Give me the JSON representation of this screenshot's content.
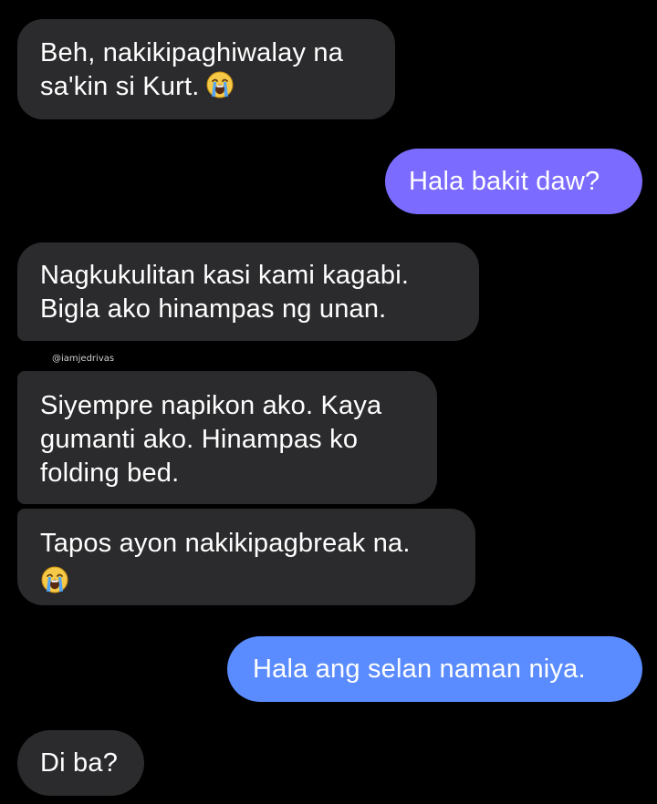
{
  "messages": [
    {
      "sender": "other",
      "lines": [
        "Beh, nakikipaghiwalay na",
        "sa'kin si Kurt."
      ],
      "emoji": "loudly-crying-face-emoji"
    },
    {
      "sender": "me",
      "text": "Hala bakit daw?",
      "color": "#7b6cff"
    },
    {
      "sender": "other",
      "lines": [
        "Nagkukulitan kasi kami kagabi.",
        "Bigla ako hinampas ng unan."
      ]
    },
    {
      "sender": "other",
      "lines": [
        "Siyempre napikon ako. Kaya",
        "gumanti ako. Hinampas ko",
        "folding bed."
      ]
    },
    {
      "sender": "other",
      "lines": [
        "Tapos ayon nakikipagbreak na."
      ],
      "emoji": "loudly-crying-face-emoji"
    },
    {
      "sender": "me",
      "text": "Hala ang selan naman niya.",
      "color": "#5b8cff"
    },
    {
      "sender": "other",
      "text": "Di ba?"
    }
  ],
  "watermark": "@iamjedrivas",
  "colors": {
    "background": "#000000",
    "incoming_bubble": "#2b2b2d",
    "outgoing_bubble_purple": "#7b6cff",
    "outgoing_bubble_blue": "#5b8cff"
  }
}
